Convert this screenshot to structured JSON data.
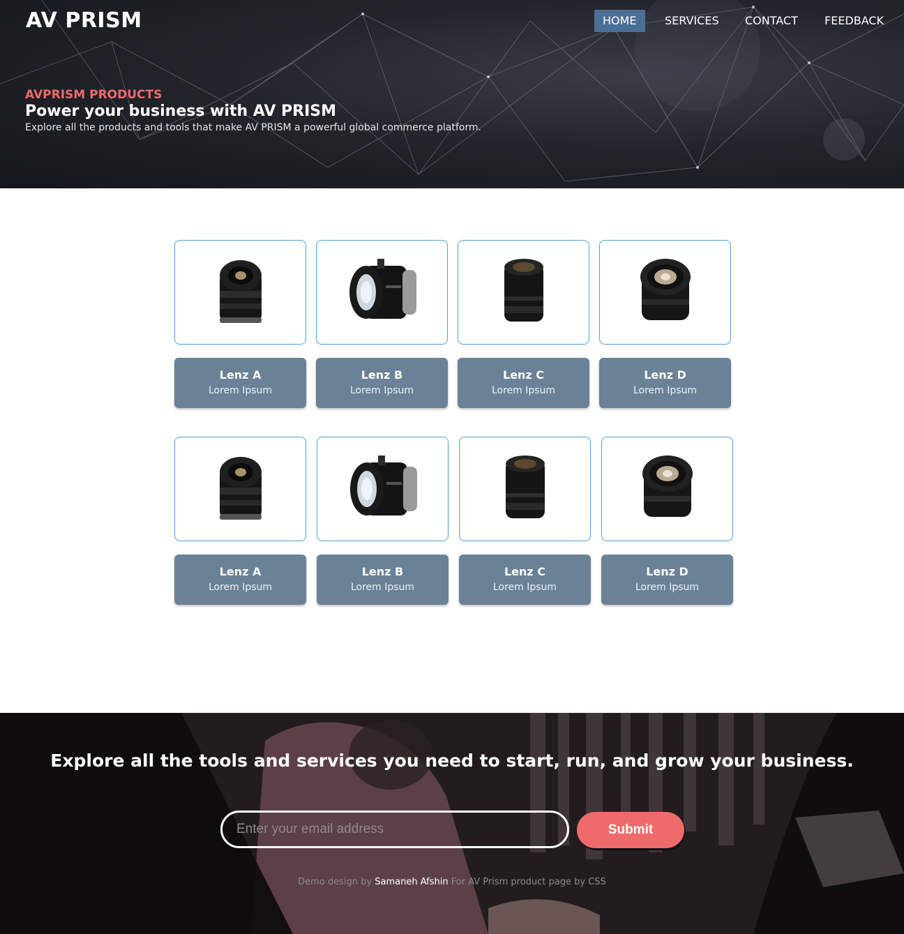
{
  "header": {
    "brand": "AV PRISM",
    "nav": [
      {
        "label": "HOME",
        "active": true
      },
      {
        "label": "SERVICES",
        "active": false
      },
      {
        "label": "CONTACT",
        "active": false
      },
      {
        "label": "FEEDBACK",
        "active": false
      }
    ]
  },
  "hero": {
    "kicker": "AVPRISM PRODUCTS",
    "title": "Power your business with AV PRISM",
    "subtitle": "Explore all the products and tools that make AV PRISM a powerful global commerce platform."
  },
  "products": {
    "rows": [
      [
        {
          "name": "Lenz A",
          "desc": "Lorem Ipsum",
          "icon": "lens-a-image"
        },
        {
          "name": "Lenz B",
          "desc": "Lorem Ipsum",
          "icon": "lens-b-image"
        },
        {
          "name": "Lenz C",
          "desc": "Lorem Ipsum",
          "icon": "lens-c-image"
        },
        {
          "name": "Lenz D",
          "desc": "Lorem Ipsum",
          "icon": "lens-d-image"
        }
      ],
      [
        {
          "name": "Lenz A",
          "desc": "Lorem Ipsum",
          "icon": "lens-a-image"
        },
        {
          "name": "Lenz B",
          "desc": "Lorem Ipsum",
          "icon": "lens-b-image"
        },
        {
          "name": "Lenz C",
          "desc": "Lorem Ipsum",
          "icon": "lens-c-image"
        },
        {
          "name": "Lenz D",
          "desc": "Lorem Ipsum",
          "icon": "lens-d-image"
        }
      ]
    ]
  },
  "footer": {
    "headline": "Explore all the tools and services you need to start, run, and grow your business.",
    "email_placeholder": "Enter your email address",
    "submit_label": "Submit",
    "credit_prefix": "Demo design by",
    "credit_author": "Samaneh Afshin",
    "credit_suffix": "For AV Prism product page by CSS"
  },
  "colors": {
    "accent": "#ef6a6a",
    "nav_active": "#4b6e96",
    "card_border": "#4c9ee6",
    "card_caption": "#6b8197"
  }
}
